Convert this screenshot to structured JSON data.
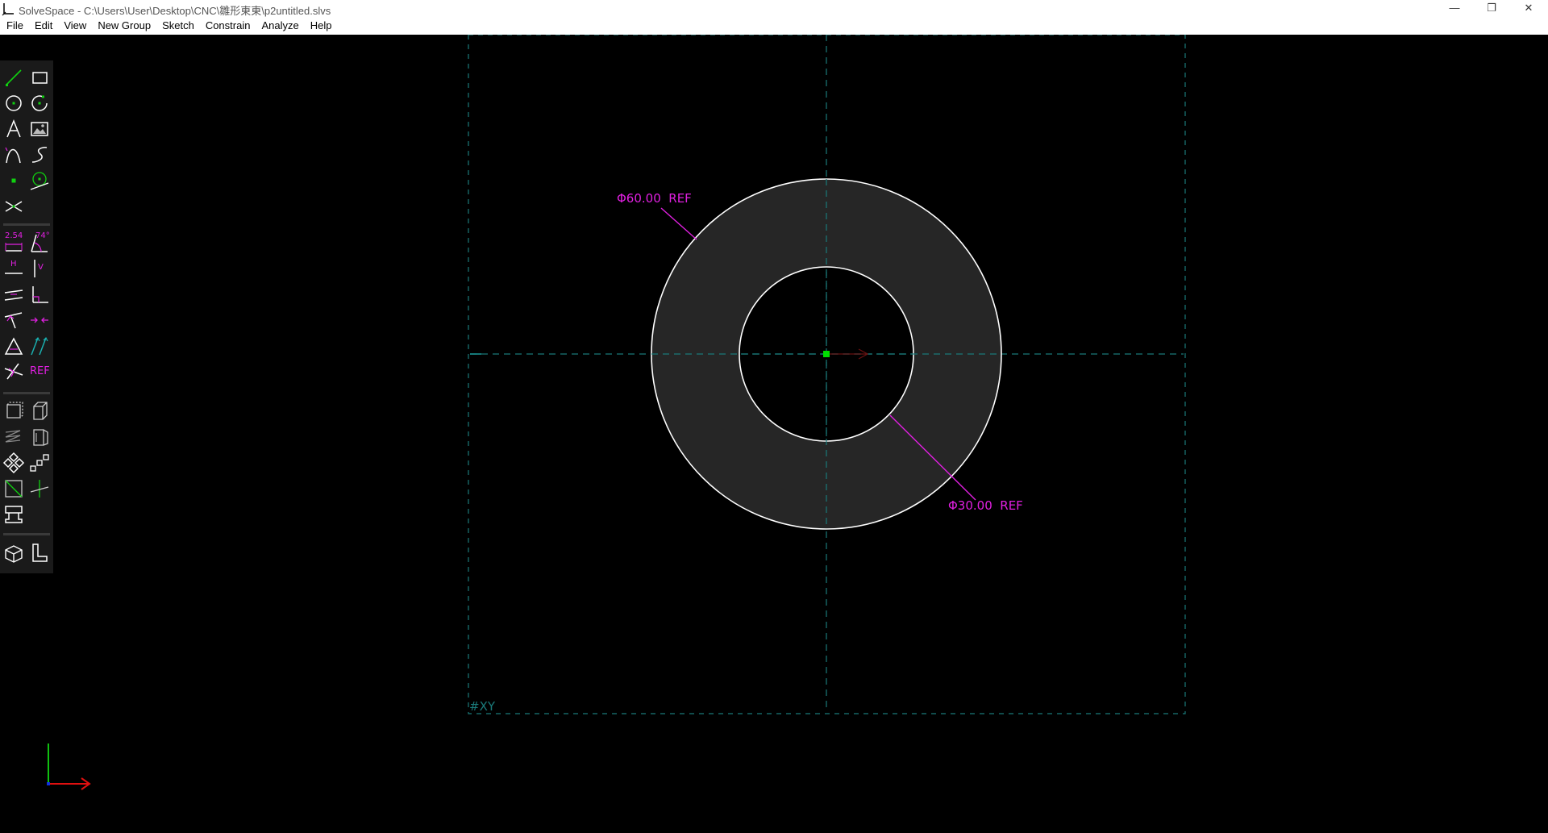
{
  "window": {
    "title": "SolveSpace - C:\\Users\\User\\Desktop\\CNC\\雛形東東\\p2untitled.slvs",
    "minimize": "—",
    "restore": "❐",
    "close": "✕"
  },
  "menu": [
    "File",
    "Edit",
    "View",
    "New Group",
    "Sketch",
    "Constrain",
    "Analyze",
    "Help"
  ],
  "toolbar": {
    "dimension_label": "2.54",
    "angle_label": "74°",
    "horizontal_label": "H",
    "vertical_label": "V",
    "reference_label": "REF"
  },
  "sketch": {
    "workplane_label": "#XY",
    "outer_dimension": "Φ60.00  REF",
    "inner_dimension": "Φ30.00  REF"
  },
  "colors": {
    "background": "#000000",
    "entity": "#ffffff",
    "dimension": "#e020e0",
    "construction": "#1a7a7a",
    "point": "#00dd00",
    "region_fill": "#262626",
    "axis_x": "#e01010",
    "axis_y": "#10c010",
    "axis_z": "#1030e0"
  }
}
